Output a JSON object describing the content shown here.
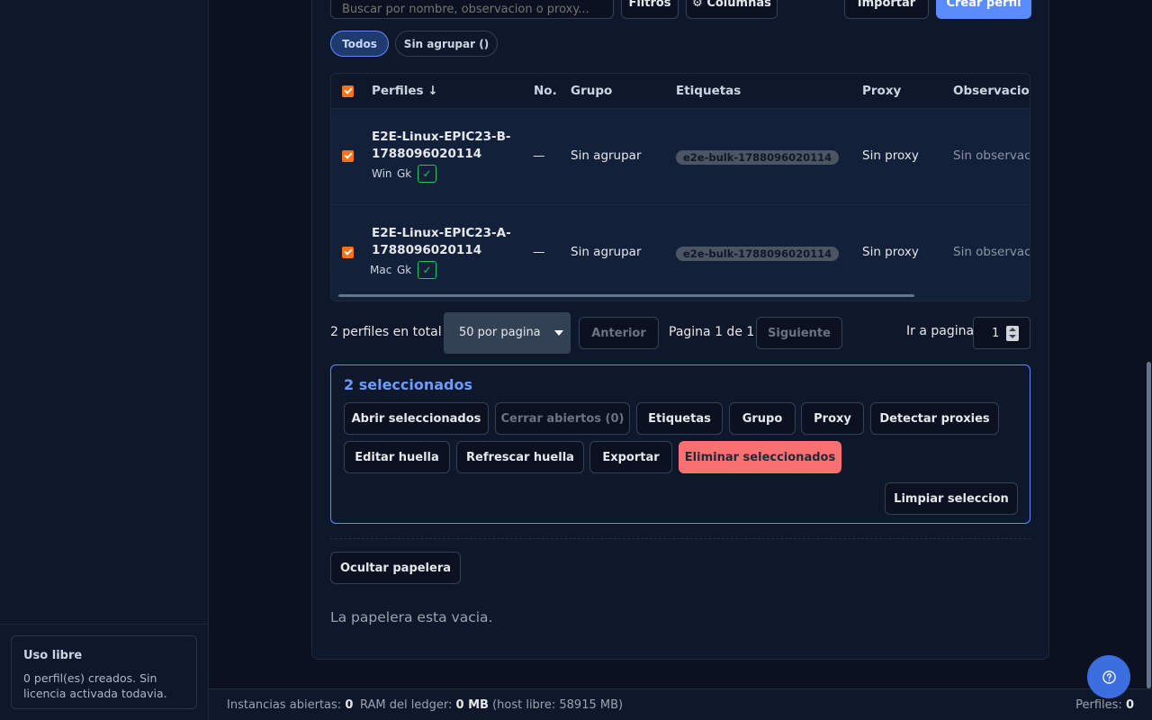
{
  "sidebar": {
    "license_card": {
      "title": "Uso libre",
      "text": "0 perfil(es) creados. Sin licencia activada todavia."
    }
  },
  "toolbar": {
    "search_placeholder": "Buscar por nombre, observacion o proxy...",
    "filters_label": "Filtros",
    "columns_label": "⚙ Columnas",
    "import_label": "Importar",
    "create_label": "Crear perfil"
  },
  "groups": [
    {
      "label": "Todos",
      "active": true
    },
    {
      "label": "Sin agrupar ()",
      "active": false
    }
  ],
  "table": {
    "headers": {
      "profiles": "Perfiles ↓",
      "number": "No.",
      "group": "Grupo",
      "tags": "Etiquetas",
      "proxy": "Proxy",
      "notes": "Observacion"
    },
    "rows": [
      {
        "name": "E2E-Linux-EPIC23-B-1788096020114",
        "os": "Win",
        "engine": "Gk",
        "status_icon": "check-icon",
        "number": "—",
        "group": "Sin agrupar",
        "tag": "e2e-bulk-1788096020114",
        "proxy": "Sin proxy",
        "notes": "Sin observaci"
      },
      {
        "name": "E2E-Linux-EPIC23-A-1788096020114",
        "os": "Mac",
        "engine": "Gk",
        "status_icon": "check-icon",
        "number": "—",
        "group": "Sin agrupar",
        "tag": "e2e-bulk-1788096020114",
        "proxy": "Sin proxy",
        "notes": "Sin observaci"
      }
    ]
  },
  "pagination": {
    "total_text": "2 perfiles en total",
    "per_page": "50 por pagina",
    "prev_label": "Anterior",
    "page_info": "Pagina 1 de 1",
    "next_label": "Siguiente",
    "goto_label": "Ir a pagina",
    "goto_value": "1"
  },
  "selection": {
    "title": "2 seleccionados",
    "actions": {
      "open": "Abrir seleccionados",
      "close": "Cerrar abiertos (0)",
      "tags": "Etiquetas",
      "group": "Grupo",
      "proxy": "Proxy",
      "detect": "Detectar proxies",
      "edit_fp": "Editar huella",
      "refresh_fp": "Refrescar huella",
      "export": "Exportar",
      "delete": "Eliminar seleccionados",
      "clear": "Limpiar seleccion"
    }
  },
  "trash": {
    "toggle_label": "Ocultar papelera",
    "empty_text": "La papelera esta vacia."
  },
  "statusbar": {
    "instances_label": "Instancias abiertas:",
    "instances_value": "0",
    "ram_label": "RAM del ledger:",
    "ram_value": "0 MB",
    "host_free": "(host libre: 58915 MB)",
    "profiles_label": "Perfiles:",
    "profiles_value": "0"
  },
  "colors": {
    "accent": "#5b8cff",
    "danger": "#f87171",
    "checkbox": "#f97316",
    "success": "#22c55e"
  }
}
